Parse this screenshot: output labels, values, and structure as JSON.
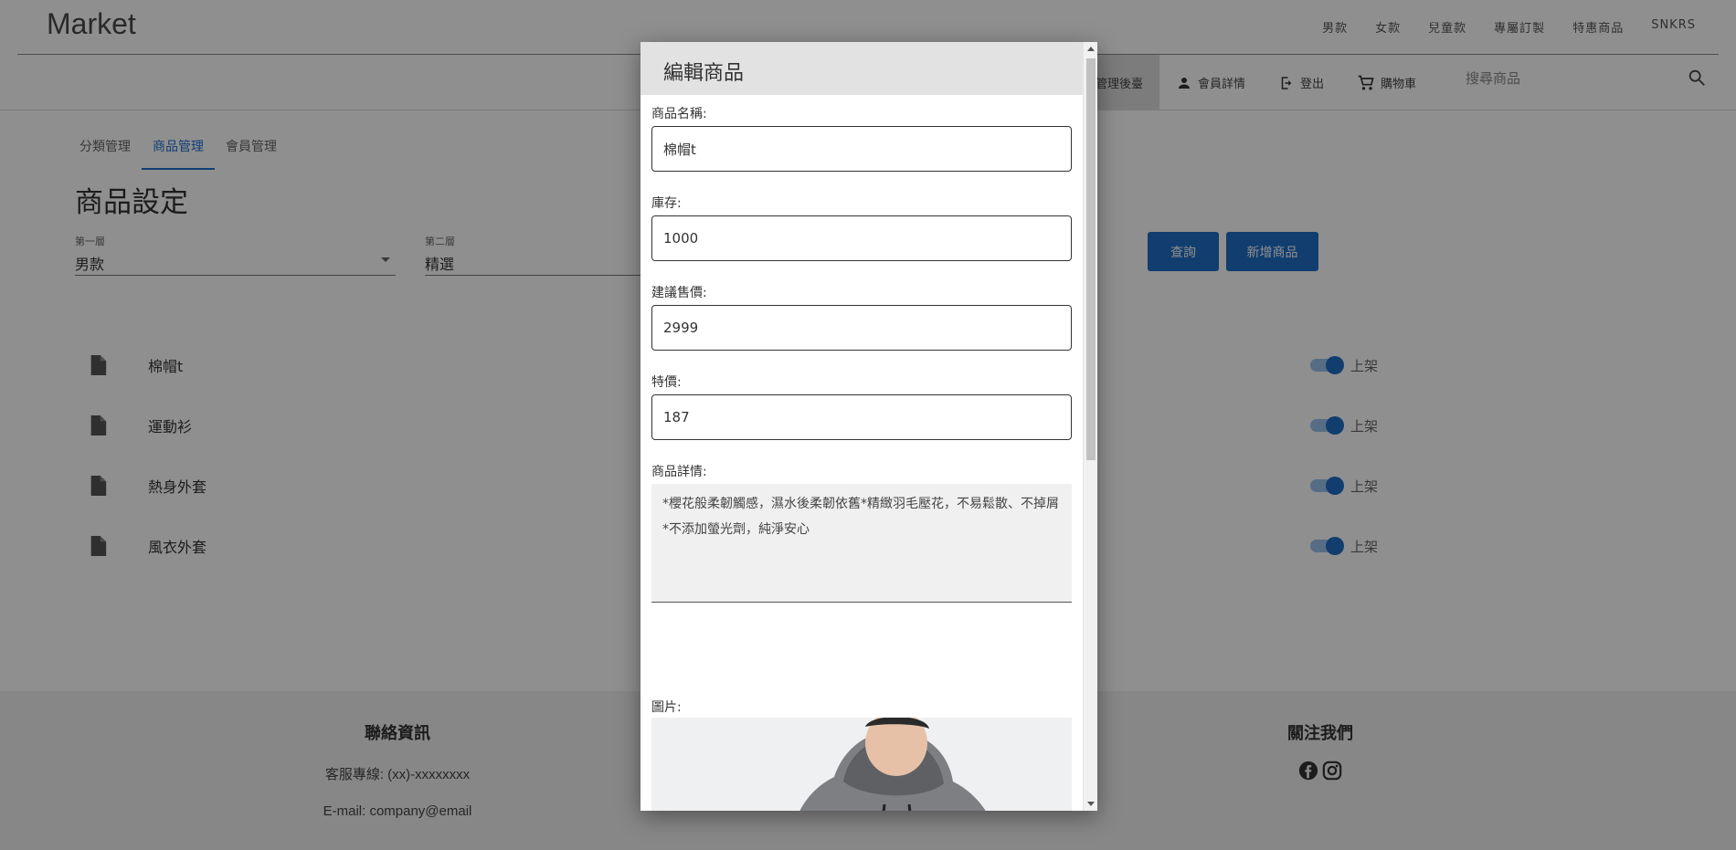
{
  "brand": "Market",
  "top_nav": [
    "男款",
    "女款",
    "兒童款",
    "專屬訂製",
    "特惠商品",
    "SNKRS"
  ],
  "sub_nav": {
    "admin": "管理後臺",
    "member": "會員詳情",
    "logout": "登出",
    "cart": "購物車"
  },
  "search": {
    "placeholder": "搜尋商品"
  },
  "tabs": [
    "分類管理",
    "商品管理",
    "會員管理"
  ],
  "active_tab": "商品管理",
  "page_title": "商品設定",
  "filters": {
    "level1_label": "第一層",
    "level1_value": "男款",
    "level2_label": "第二層",
    "level2_value": "精選"
  },
  "buttons": {
    "query": "查詢",
    "add_product": "新增商品"
  },
  "products": [
    {
      "name": "棉帽t",
      "status": "上架"
    },
    {
      "name": "運動衫",
      "status": "上架"
    },
    {
      "name": "熱身外套",
      "status": "上架"
    },
    {
      "name": "風衣外套",
      "status": "上架"
    }
  ],
  "footer": {
    "contact_title": "聯絡資訊",
    "phone": "客服專線: (xx)-xxxxxxxx",
    "email": "E-mail: company@email",
    "follow_title": "關注我們"
  },
  "modal": {
    "title": "編輯商品",
    "name_label": "商品名稱:",
    "name_value": "棉帽t",
    "stock_label": "庫存:",
    "stock_value": "1000",
    "price_label": "建議售價:",
    "price_value": "2999",
    "special_label": "特價:",
    "special_value": "187",
    "detail_label": "商品詳情:",
    "detail_value": "*櫻花般柔韌觸感，濕水後柔韌依舊*精緻羽毛壓花，不易鬆散、不掉屑*不添加螢光劑，純淨安心",
    "image_label": "圖片:"
  },
  "colors": {
    "accent": "#1f6ec6",
    "overlay": "rgba(0,0,0,0.44)",
    "modal_header": "#e2e2e2"
  }
}
